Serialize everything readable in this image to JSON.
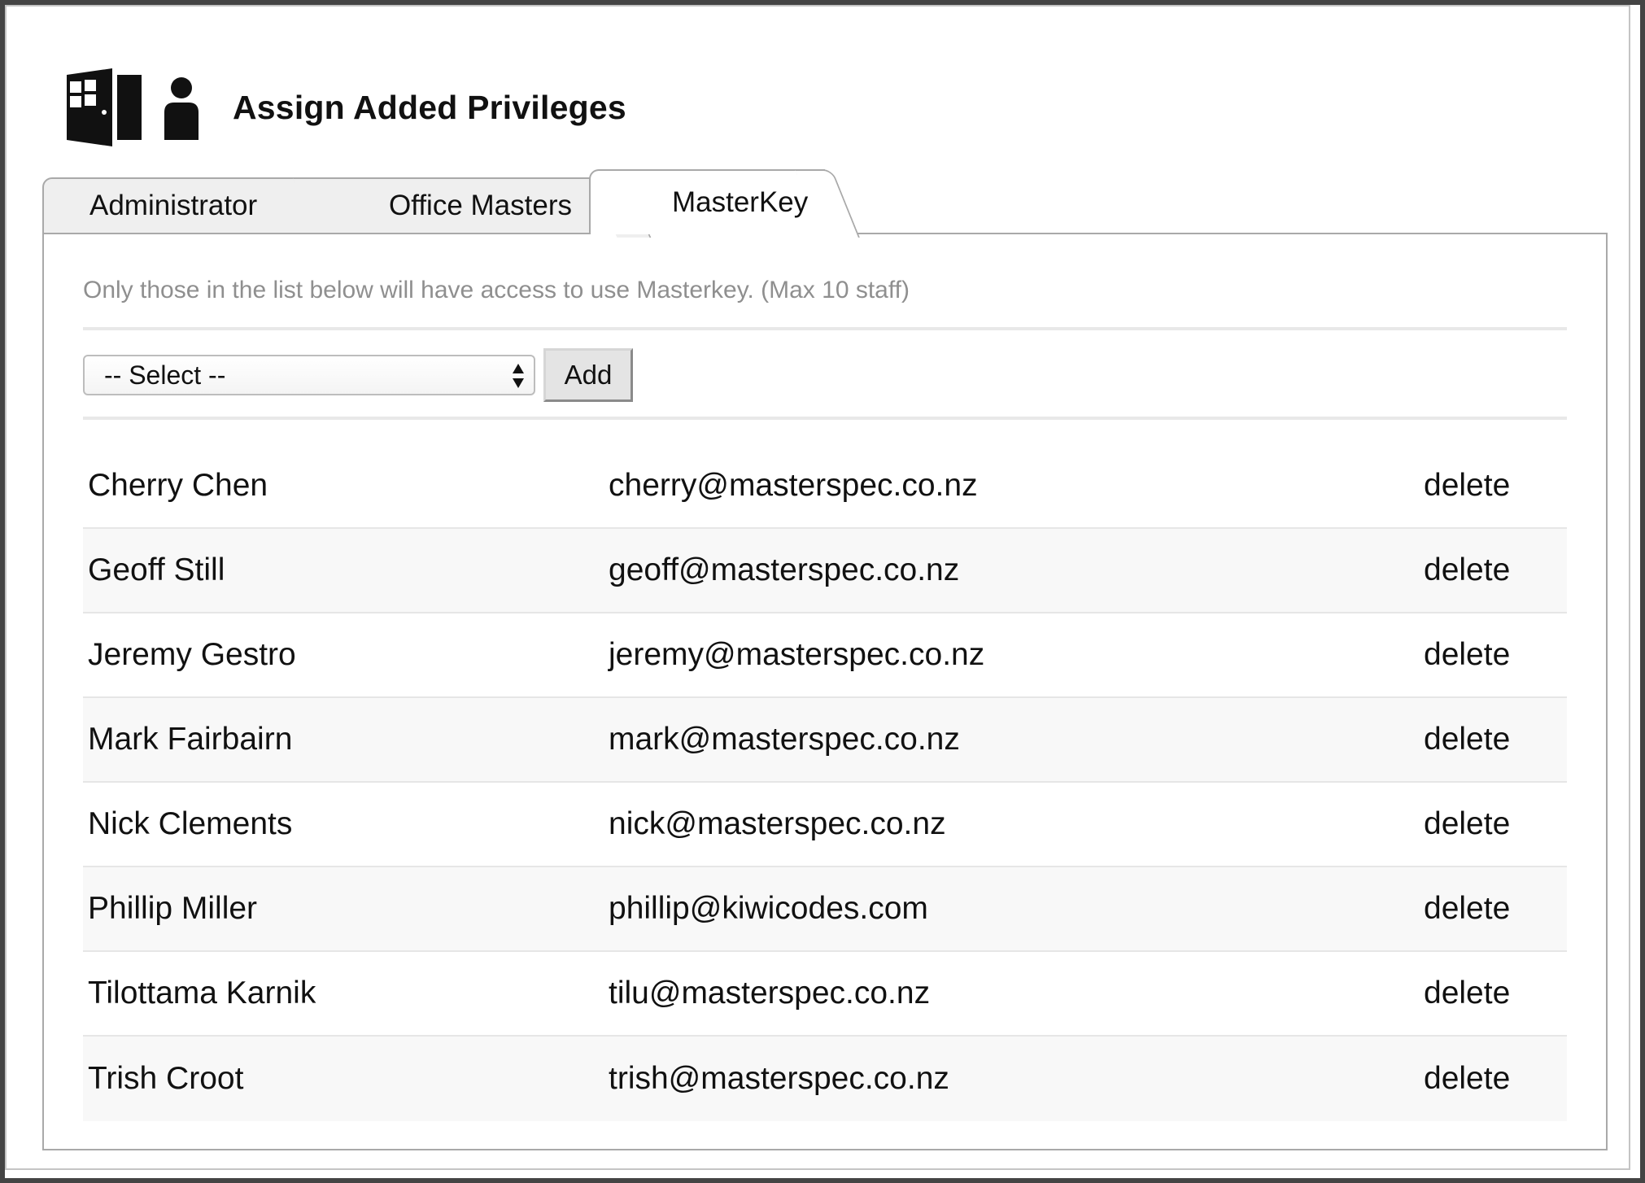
{
  "header": {
    "title": "Assign Added Privileges",
    "logo_icon": "building-door-icon",
    "person_icon": "person-icon"
  },
  "tabs": [
    {
      "label": "Administrator",
      "active": false
    },
    {
      "label": "Office Masters",
      "active": false
    },
    {
      "label": "MasterKey",
      "active": true
    }
  ],
  "panel": {
    "info_text": "Only those in the list below will have access to use Masterkey. (Max 10 staff)",
    "select": {
      "selected": "-- Select --"
    },
    "add_label": "Add"
  },
  "staff": [
    {
      "name": "Cherry Chen",
      "email": "cherry@masterspec.co.nz",
      "action": "delete"
    },
    {
      "name": "Geoff Still",
      "email": "geoff@masterspec.co.nz",
      "action": "delete"
    },
    {
      "name": "Jeremy Gestro",
      "email": "jeremy@masterspec.co.nz",
      "action": "delete"
    },
    {
      "name": "Mark Fairbairn",
      "email": "mark@masterspec.co.nz",
      "action": "delete"
    },
    {
      "name": "Nick Clements",
      "email": "nick@masterspec.co.nz",
      "action": "delete"
    },
    {
      "name": "Phillip Miller",
      "email": "phillip@kiwicodes.com",
      "action": "delete"
    },
    {
      "name": "Tilottama Karnik",
      "email": "tilu@masterspec.co.nz",
      "action": "delete"
    },
    {
      "name": "Trish Croot",
      "email": "trish@masterspec.co.nz",
      "action": "delete"
    }
  ],
  "colors": {
    "info_text": "#8f8f8f",
    "tab_inactive_bg": "#efefef",
    "row_alt_bg": "#f8f8f8",
    "border": "#a9a9a9"
  }
}
